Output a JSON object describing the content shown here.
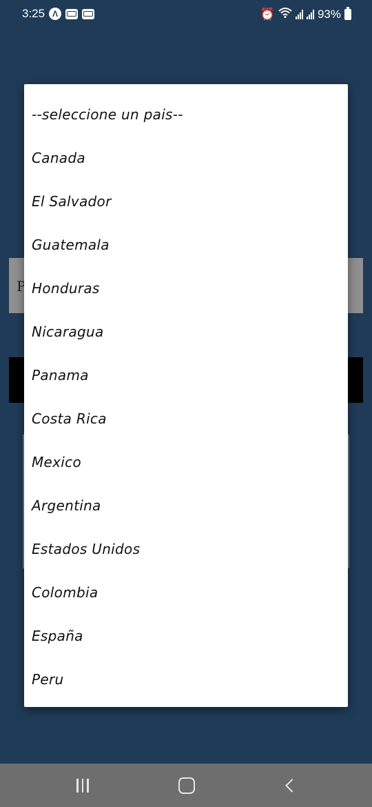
{
  "status_bar": {
    "time": "3:25",
    "battery": "93%",
    "left_icons": [
      "app-a-icon",
      "notification-icon",
      "notification-icon"
    ],
    "right_icons": [
      "alarm-icon",
      "wifi-icon",
      "signal-icon",
      "signal-icon",
      "battery-icon"
    ]
  },
  "background": {
    "gray_field_fragment": "P"
  },
  "dialog": {
    "options": [
      "--seleccione un pais--",
      "Canada",
      "El Salvador",
      "Guatemala",
      "Honduras",
      "Nicaragua",
      "Panama",
      "Costa Rica",
      "Mexico",
      "Argentina",
      "Estados Unidos",
      "Colombia",
      "España",
      "Peru"
    ]
  },
  "nav_bar": {
    "buttons": [
      "recents-icon",
      "home-icon",
      "back-icon"
    ]
  },
  "colors": {
    "background": "#1f3b57",
    "dialog": "#ffffff",
    "nav_bar": "#6e6e6e"
  }
}
